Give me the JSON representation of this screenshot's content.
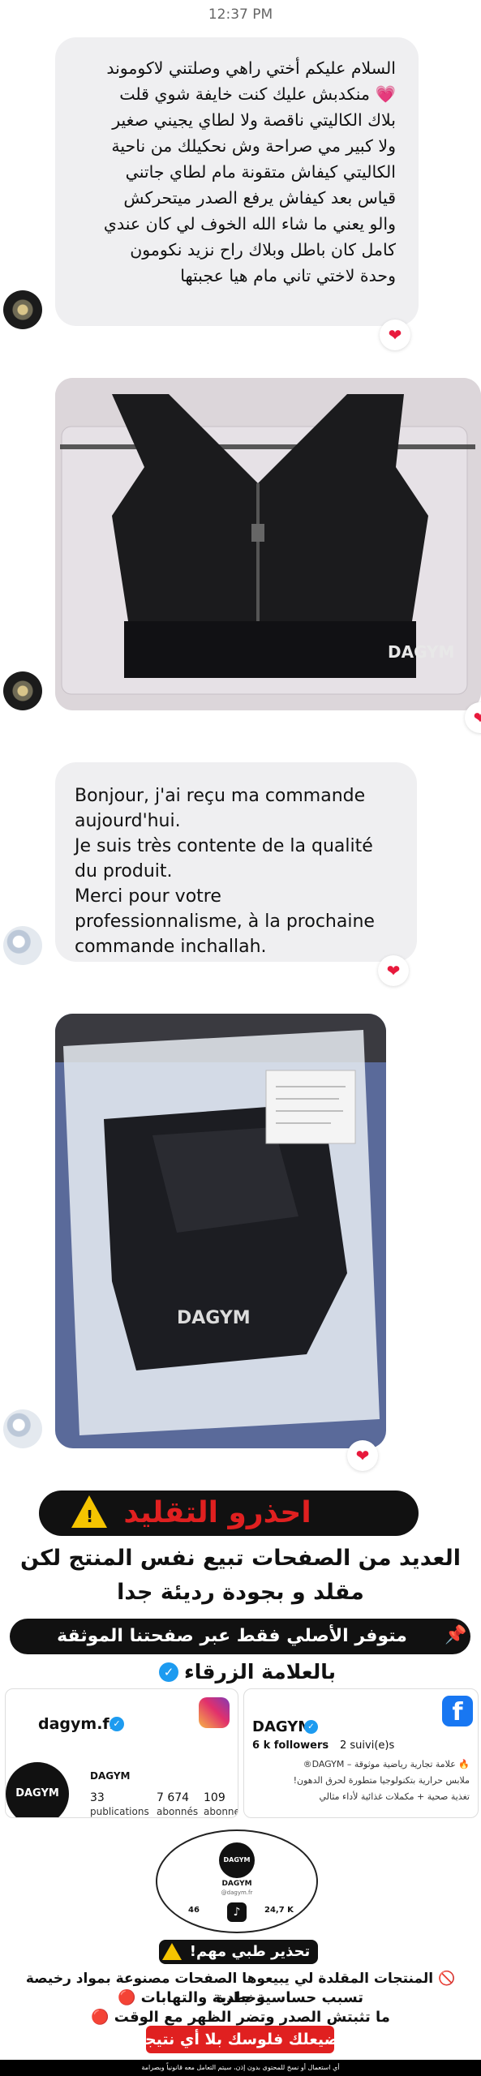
{
  "status_time": "12:37 PM",
  "messages": [
    {
      "lines": [
        "السلام عليكم أختي راهي وصلتني لاكوموند",
        "💗 منكدبش عليك كنت خايفة شوي قلت",
        "بلاك الكاليتي ناقصة ولا لطاي يجيني صغير",
        "ولا كبير مي صراحة وش نحكيلك من ناحية",
        "الكاليتي كيفاش متقونة مام لطاي جاتني",
        "قياس بعد كيفاش يرفع الصدر ميتحركش",
        "والو يعني ما شاء الله الخوف لي كان عندي",
        "كامل كان باطل وبلاك راح نزيد نكومون",
        "وحدة لاختي تاني مام هيا عجبتها"
      ],
      "reaction": "❤"
    },
    {
      "lines": [
        "Bonjour, j'ai reçu ma commande",
        "aujourd'hui.",
        "Je suis très contente de la qualité",
        "du produit.",
        "Merci pour votre",
        "professionnalisme, à la prochaine",
        "commande inchallah."
      ],
      "reaction": "❤"
    }
  ],
  "photos": [
    {
      "brand_print": "DAGYM",
      "reaction": "❤"
    },
    {
      "brand_print": "DAGYM",
      "reaction": "❤"
    }
  ],
  "warning": {
    "title": "احذرو التقليد",
    "line1": "العديد من الصفحات تبيع نفس المنتج لكن",
    "line2": "مقلد و بجودة رديئة جدا",
    "verified_banner": "متوفر الأصلي فقط عبر صفحتنا الموثقة",
    "blue_badge_line": "بالعلامة الزرقاء",
    "instagram": {
      "handle": "dagym.fr",
      "name": "DAGYM",
      "publications_count": "33",
      "publications_label": "publications",
      "followers_count": "7 674",
      "followers_label": "abonnés",
      "following_count": "109",
      "following_label": "abonnements"
    },
    "facebook": {
      "name": "DAGYM",
      "followers": "6 k followers",
      "following": "2 suivi(e)s",
      "bio_1": "🔥 علامة تجارية رياضية موثوقة – DAGYM®",
      "bio_2": "ملابس حرارية بتكنولوجيا متطورة لحرق الدهون!",
      "bio_3": "تغذية صحية + مكملات غذائية لأداء مثالي"
    },
    "tiktok": {
      "name": "DAGYM",
      "handle": "@dagym.fr",
      "following": "46",
      "followers": "24,7 K"
    },
    "caution_label": "تحذير طبي مهم!",
    "caution_1": "🚫 المنتجات المقلدة لي يبيعوها الصفحات مصنوعة بمواد رخيصة وخطرة",
    "caution_2": "تسبب حساسية جلدية والتهابات 🔴",
    "caution_3": "ما تثبتش الصدر وتضر الظهر مع الوقت 🔴",
    "caution_4": "تضيعلك فلوسك بلا أي نتيجة",
    "footer": "أي استعمال أو نسخ للمحتوى بدون إذن، سيتم التعامل معه قانونياً وبصرامة"
  },
  "colors": {
    "bubble": "#efeff1",
    "warning_red": "#e02020",
    "instagram": "#e1306c",
    "facebook": "#1877f2"
  }
}
